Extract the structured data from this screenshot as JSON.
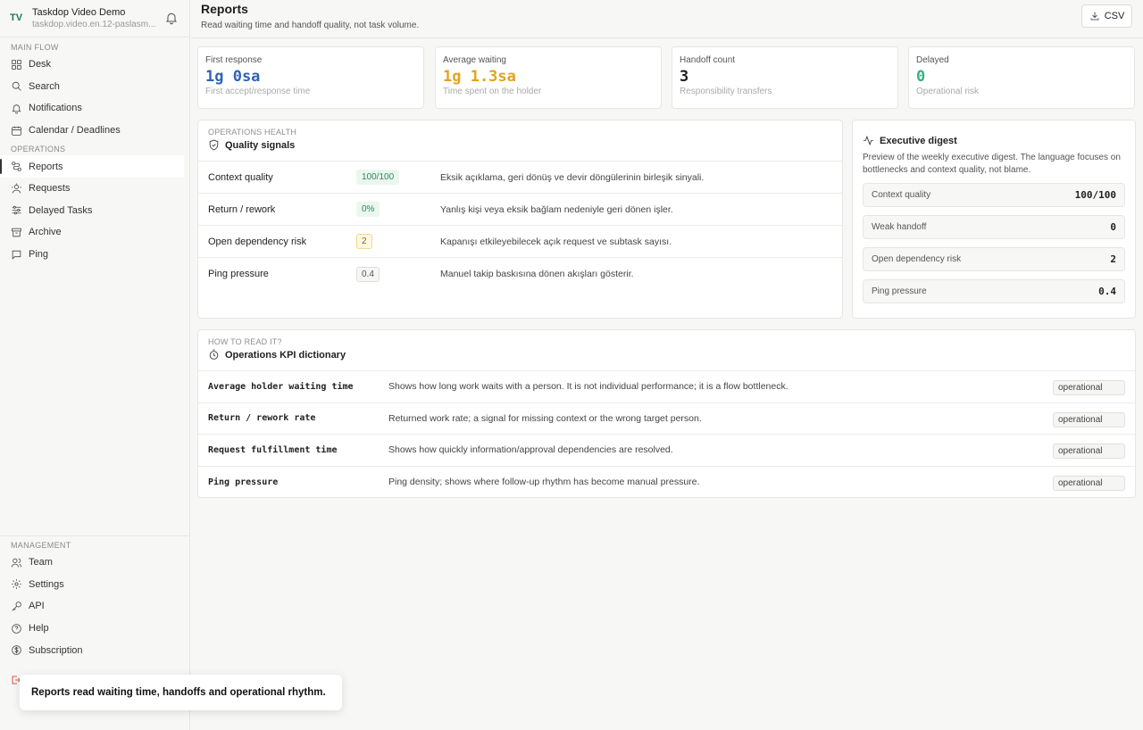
{
  "workspace": {
    "initials": "TV",
    "name": "Taskdop Video Demo",
    "url": "taskdop.video.en.12-paslasm..."
  },
  "sidebar": {
    "main_flow": {
      "title": "MAIN FLOW",
      "items": [
        {
          "label": "Desk",
          "icon": "grid-icon"
        },
        {
          "label": "Search",
          "icon": "search-icon"
        },
        {
          "label": "Notifications",
          "icon": "bell-icon"
        },
        {
          "label": "Calendar / Deadlines",
          "icon": "calendar-icon"
        }
      ]
    },
    "operations": {
      "title": "OPERATIONS",
      "items": [
        {
          "label": "Reports",
          "icon": "route-icon",
          "active": true
        },
        {
          "label": "Requests",
          "icon": "people-icon"
        },
        {
          "label": "Delayed Tasks",
          "icon": "sliders-icon"
        },
        {
          "label": "Archive",
          "icon": "archive-icon"
        },
        {
          "label": "Ping",
          "icon": "message-icon"
        }
      ]
    },
    "management": {
      "title": "MANAGEMENT",
      "items": [
        {
          "label": "Team",
          "icon": "users-icon"
        },
        {
          "label": "Settings",
          "icon": "gear-icon"
        },
        {
          "label": "API",
          "icon": "key-icon"
        },
        {
          "label": "Help",
          "icon": "help-icon"
        },
        {
          "label": "Subscription",
          "icon": "dollar-icon"
        }
      ]
    }
  },
  "header": {
    "title": "Reports",
    "subtitle": "Read waiting time and handoff quality, not task volume.",
    "csv_label": "CSV"
  },
  "kpis": [
    {
      "label": "First response",
      "value": "1g 0sa",
      "hint": "First accept/response time",
      "color": "#2f63b8"
    },
    {
      "label": "Average waiting",
      "value": "1g 1.3sa",
      "hint": "Time spent on the holder",
      "color": "#e3a21a"
    },
    {
      "label": "Handoff count",
      "value": "3",
      "hint": "Responsibility transfers",
      "color": "#1e1e1e"
    },
    {
      "label": "Delayed",
      "value": "0",
      "hint": "Operational risk",
      "color": "#34b27b"
    }
  ],
  "quality": {
    "eyebrow": "OPERATIONS HEALTH",
    "title": "Quality signals",
    "rows": [
      {
        "label": "Context quality",
        "badge": "100/100",
        "desc": "Eksik açıklama, geri dönüş ve devir döngülerinin birleşik sinyali.",
        "badge_bg": "#eaf7ef",
        "badge_fg": "#2c8a55",
        "badge_border": "#eaf7ef"
      },
      {
        "label": "Return / rework",
        "badge": "0%",
        "desc": "Yanlış kişi veya eksik bağlam nedeniyle geri dönen işler.",
        "badge_bg": "#eaf7ef",
        "badge_fg": "#2c8a55",
        "badge_border": "#eaf7ef"
      },
      {
        "label": "Open dependency risk",
        "badge": "2",
        "desc": "Kapanışı etkileyebilecek açık request ve subtask sayısı.",
        "badge_bg": "#fdf7e6",
        "badge_fg": "#8a6a10",
        "badge_border": "#f1d98c"
      },
      {
        "label": "Ping pressure",
        "badge": "0.4",
        "desc": "Manuel takip baskısına dönen akışları gösterir.",
        "badge_bg": "#f6f6f5",
        "badge_fg": "#555555",
        "badge_border": "#dddddd"
      }
    ]
  },
  "digest": {
    "title": "Executive digest",
    "desc": "Preview of the weekly executive digest. The language focuses on bottlenecks and context quality, not blame.",
    "rows": [
      {
        "label": "Context quality",
        "value": "100/100"
      },
      {
        "label": "Weak handoff",
        "value": "0"
      },
      {
        "label": "Open dependency risk",
        "value": "2"
      },
      {
        "label": "Ping pressure",
        "value": "0.4"
      }
    ]
  },
  "dictionary": {
    "eyebrow": "HOW TO READ IT?",
    "title": "Operations KPI dictionary",
    "rows": [
      {
        "term": "Average holder waiting time",
        "desc": "Shows how long work waits with a person. It is not individual performance; it is a flow bottleneck.",
        "tag": "operational"
      },
      {
        "term": "Return / rework rate",
        "desc": "Returned work rate; a signal for missing context or the wrong target person.",
        "tag": "operational"
      },
      {
        "term": "Request fulfillment time",
        "desc": "Shows how quickly information/approval dependencies are resolved.",
        "tag": "operational"
      },
      {
        "term": "Ping pressure",
        "desc": "Ping density; shows where follow-up rhythm has become manual pressure.",
        "tag": "operational"
      }
    ]
  },
  "toast": {
    "text": "Reports read waiting time, handoffs and operational rhythm."
  }
}
